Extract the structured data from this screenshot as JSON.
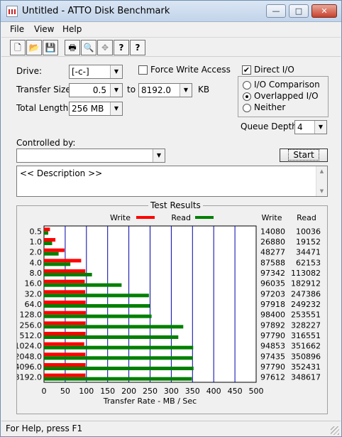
{
  "window": {
    "title": "Untitled - ATTO Disk Benchmark",
    "minimize": "—",
    "maximize": "□",
    "close": "✕"
  },
  "menu": [
    "File",
    "View",
    "Help"
  ],
  "toolbar": [
    {
      "name": "new-icon",
      "glyph": "🗋"
    },
    {
      "name": "open-icon",
      "glyph": "📂"
    },
    {
      "name": "save-icon",
      "glyph": "💾"
    },
    {
      "name": "print-icon",
      "glyph": "🖶"
    },
    {
      "name": "print-preview-icon",
      "glyph": "🔍"
    },
    {
      "name": "move-icon",
      "glyph": "✥"
    },
    {
      "name": "help-icon",
      "glyph": "?"
    },
    {
      "name": "context-help-icon",
      "glyph": "?"
    }
  ],
  "form": {
    "drive_label": "Drive:",
    "drive_value": "[-c-]",
    "force_write_label": "Force Write Access",
    "force_write_checked": false,
    "direct_io_label": "Direct I/O",
    "direct_io_checked": true,
    "transfer_size_label": "Transfer Size:",
    "transfer_from": "0.5",
    "to_label": "to",
    "transfer_to": "8192.0",
    "kb_label": "KB",
    "total_length_label": "Total Length:",
    "total_length_value": "256 MB",
    "io_options": [
      "I/O Comparison",
      "Overlapped I/O",
      "Neither"
    ],
    "io_selected": 1,
    "queue_depth_label": "Queue Depth:",
    "queue_depth_value": "4",
    "controlled_by_label": "Controlled by:",
    "controlled_by_value": "",
    "start_label": "Start",
    "description": "<< Description >>"
  },
  "results": {
    "title": "Test Results",
    "legend_write": "Write",
    "legend_read": "Read",
    "col_write": "Write",
    "col_read": "Read",
    "write_color": "#ff0000",
    "read_color": "#008000",
    "grid_color": "#0000aa"
  },
  "chart_data": {
    "type": "bar",
    "orientation": "horizontal",
    "xlabel": "Transfer Rate - MB / Sec",
    "xlim": [
      0,
      500
    ],
    "xticks": [
      0,
      50,
      100,
      150,
      200,
      250,
      300,
      350,
      400,
      450,
      500
    ],
    "categories": [
      "0.5",
      "1.0",
      "2.0",
      "4.0",
      "8.0",
      "16.0",
      "32.0",
      "64.0",
      "128.0",
      "256.0",
      "512.0",
      "1024.0",
      "2048.0",
      "4096.0",
      "8192.0"
    ],
    "series": [
      {
        "name": "Write",
        "values": [
          14080,
          26880,
          48277,
          87588,
          97342,
          96035,
          97203,
          97918,
          98400,
          97892,
          97790,
          94853,
          97435,
          97790,
          97612
        ]
      },
      {
        "name": "Read",
        "values": [
          10036,
          19152,
          34471,
          62153,
          113082,
          182912,
          247386,
          249232,
          253551,
          328227,
          316551,
          351662,
          350896,
          352431,
          348617
        ]
      }
    ],
    "write_labels": [
      "14080",
      "26880",
      "48277",
      "87588",
      "97342",
      "96035",
      "97203",
      "97918",
      "98400",
      "97892",
      "97790",
      "94853",
      "97435",
      "97790",
      "97612"
    ],
    "read_labels": [
      "10036",
      "19152",
      "34471",
      "62153",
      "113082",
      "182912",
      "247386",
      "249232",
      "253551",
      "328227",
      "316551",
      "351662",
      "350896",
      "352431",
      "348617"
    ],
    "value_unit_divisor": 1000
  },
  "status": {
    "text": "For Help, press F1"
  }
}
